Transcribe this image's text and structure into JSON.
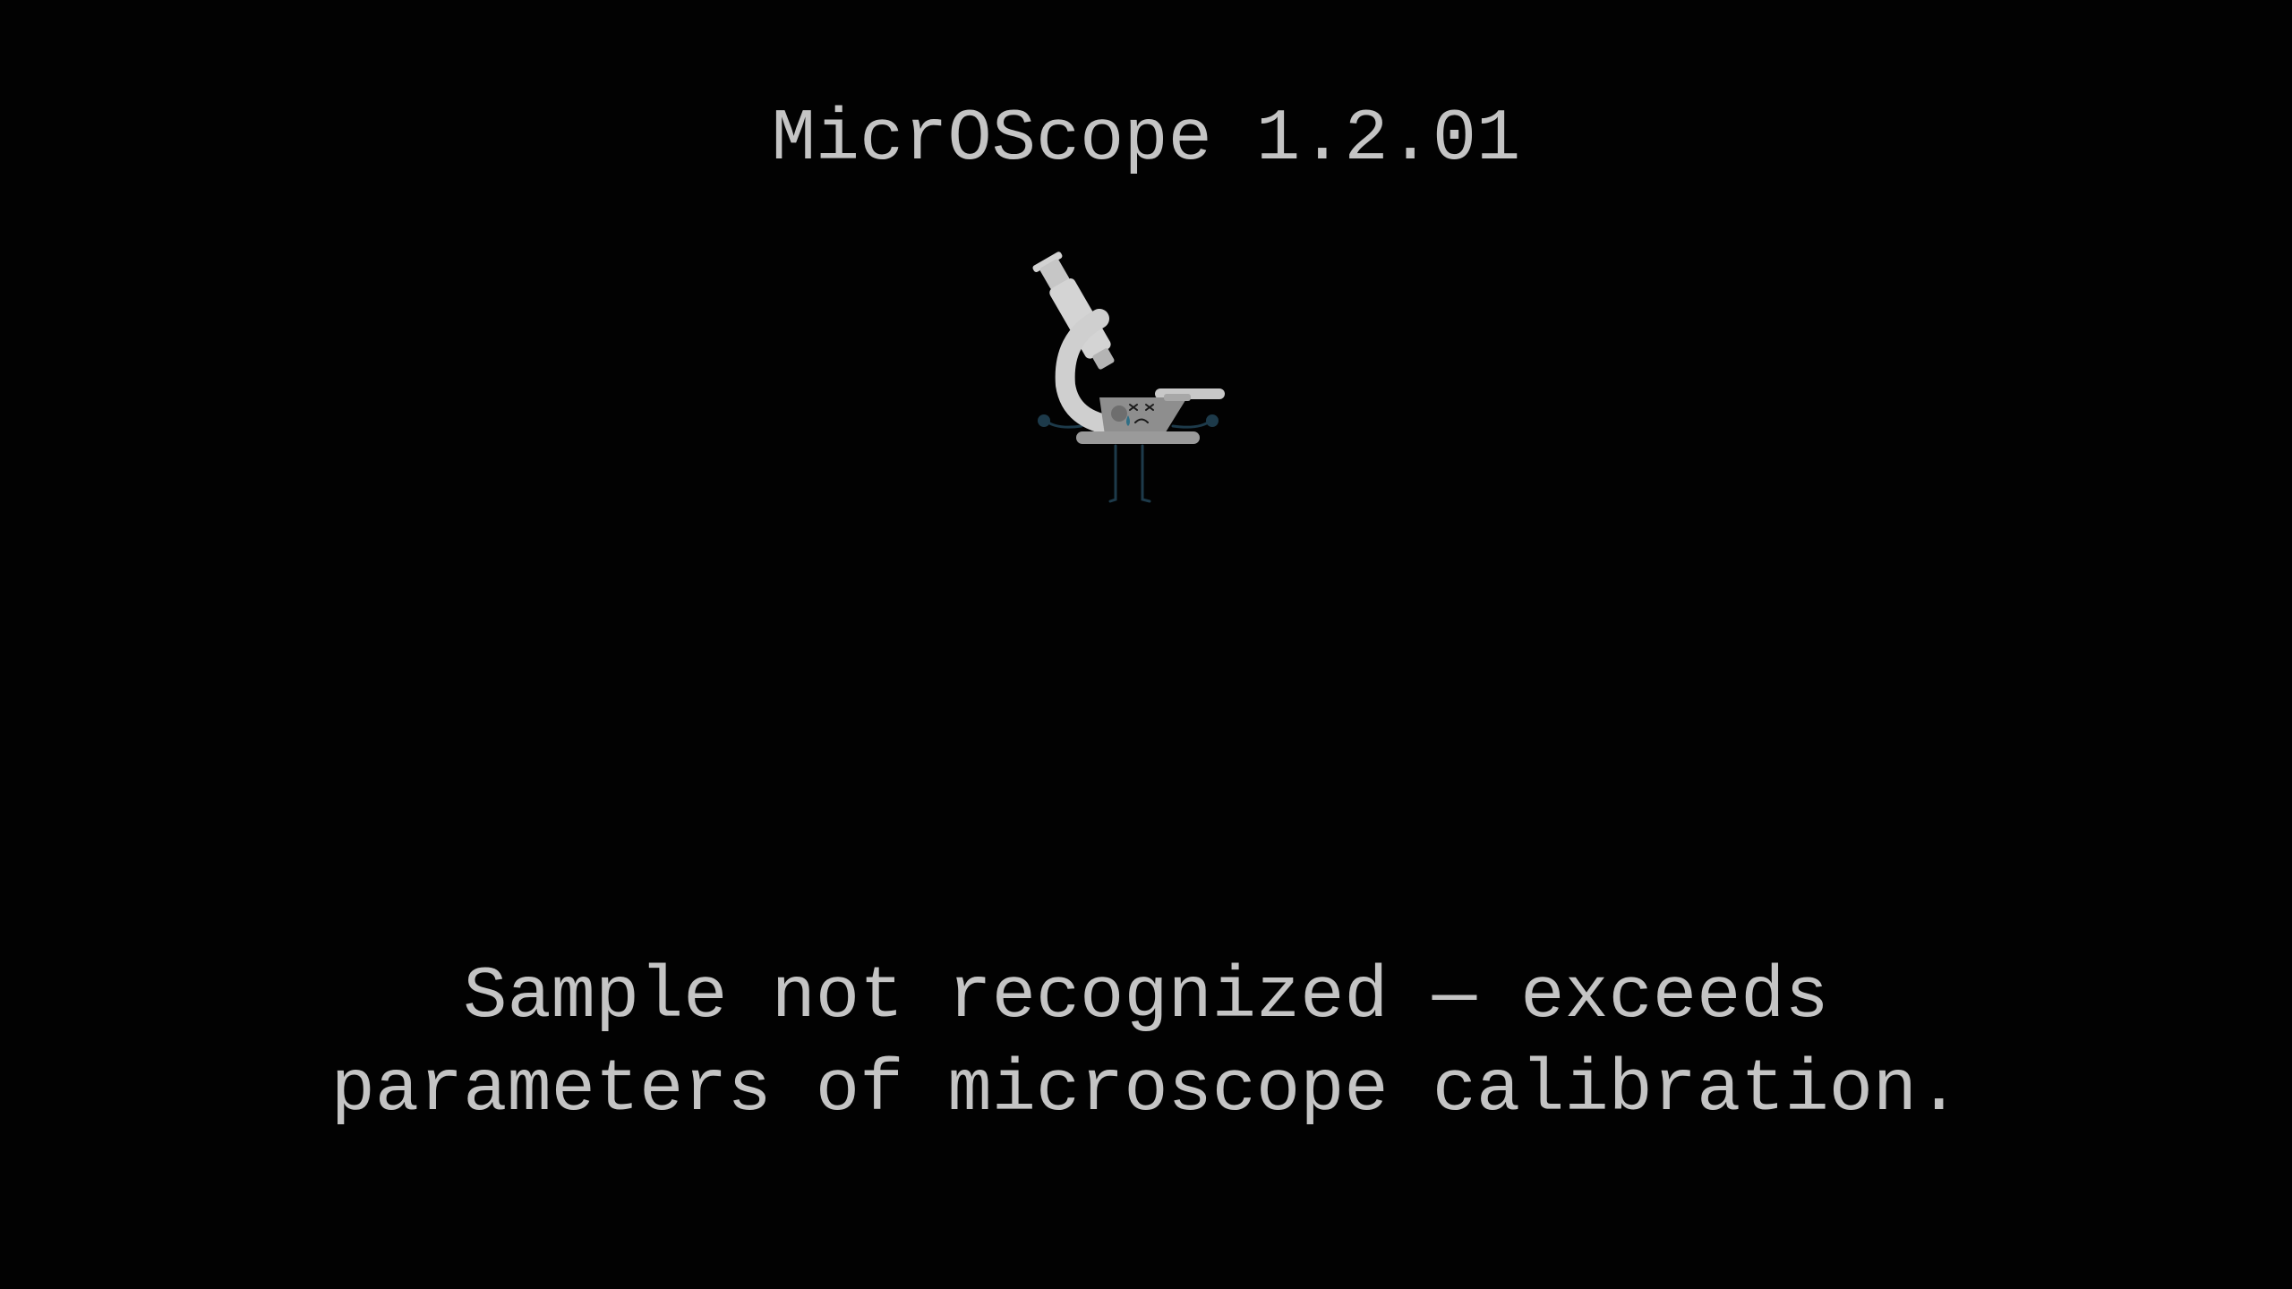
{
  "app": {
    "title": "MicrOScope 1.2.01"
  },
  "mascot": {
    "icon": "sad-microscope-icon",
    "colors": {
      "body": "#c8c8c8",
      "base": "#8c8c8c",
      "limbs": "#1d3a4a",
      "tear": "#2f6f86"
    }
  },
  "error": {
    "line1": "Sample not recognized — exceeds",
    "line2": "parameters of microscope calibration."
  }
}
